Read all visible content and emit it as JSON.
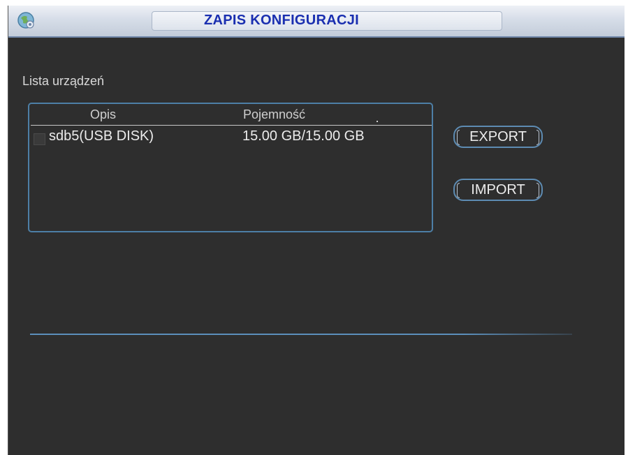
{
  "window": {
    "title": "ZAPIS KONFIGURACJI",
    "icon": "gear-globe-icon"
  },
  "device_list": {
    "label": "Lista urządzeń",
    "columns": [
      "Opis",
      "Pojemność"
    ],
    "rows": [
      {
        "checked": false,
        "opis": "sdb5(USB DISK)",
        "pojemnosc": "15.00 GB/15.00 GB"
      }
    ]
  },
  "actions": {
    "export_label": "EXPORT",
    "import_label": "IMPORT"
  },
  "colors": {
    "title_text": "#1a2fb0",
    "background": "#2e2e2e",
    "accent_border": "#4d7fa6"
  }
}
